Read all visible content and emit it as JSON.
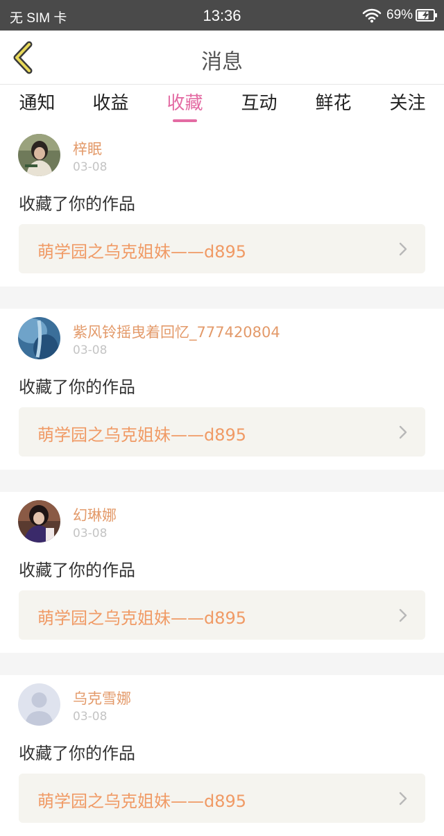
{
  "status_bar": {
    "carrier": "无 SIM 卡",
    "time": "13:36",
    "battery": "69%"
  },
  "header": {
    "title": "消息",
    "back_icon": "chevron-left-icon"
  },
  "tabs": [
    {
      "label": "通知",
      "active": false
    },
    {
      "label": "收益",
      "active": false
    },
    {
      "label": "收藏",
      "active": true
    },
    {
      "label": "互动",
      "active": false
    },
    {
      "label": "鲜花",
      "active": false
    },
    {
      "label": "关注",
      "active": false
    }
  ],
  "notifications": [
    {
      "username": "梓眠",
      "date": "03-08",
      "action": "收藏了你的作品",
      "work_title": "萌学园之乌克姐妹——d895",
      "avatar": "photo-avatar"
    },
    {
      "username": "紫风铃摇曳着回忆_777420804",
      "date": "03-08",
      "action": "收藏了你的作品",
      "work_title": "萌学园之乌克姐妹——d895",
      "avatar": "photo-avatar"
    },
    {
      "username": "幻琳娜",
      "date": "03-08",
      "action": "收藏了你的作品",
      "work_title": "萌学园之乌克姐妹——d895",
      "avatar": "photo-avatar"
    },
    {
      "username": "乌克雪娜",
      "date": "03-08",
      "action": "收藏了你的作品",
      "work_title": "萌学园之乌克姐妹——d895",
      "avatar": "default-user-avatar"
    }
  ],
  "colors": {
    "accent": "#e36ba3",
    "username": "#e39a6a",
    "work_title": "#f09a65",
    "status_bar": "#4a4a4a"
  }
}
